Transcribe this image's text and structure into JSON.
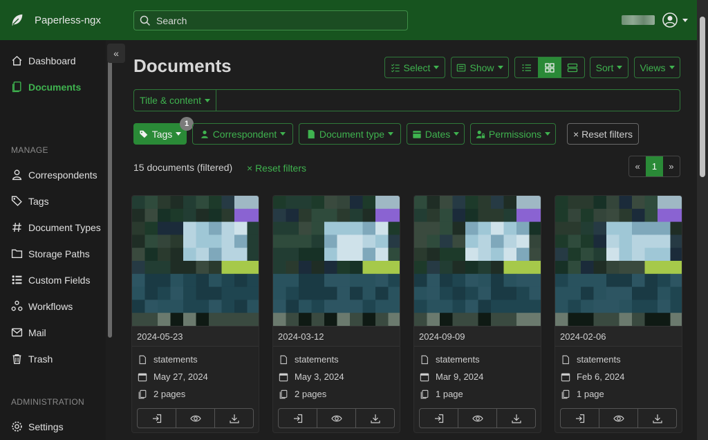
{
  "app": {
    "name": "Paperless-ngx"
  },
  "search": {
    "placeholder": "Search"
  },
  "sidebar": {
    "items_top": [
      {
        "label": "Dashboard",
        "icon": "house-icon"
      },
      {
        "label": "Documents",
        "icon": "documents-icon",
        "active": true
      }
    ],
    "manage_label": "MANAGE",
    "manage_items": [
      {
        "label": "Correspondents",
        "icon": "person-icon"
      },
      {
        "label": "Tags",
        "icon": "tags-icon"
      },
      {
        "label": "Document Types",
        "icon": "hash-icon"
      },
      {
        "label": "Storage Paths",
        "icon": "folder-icon"
      },
      {
        "label": "Custom Fields",
        "icon": "custom-fields-icon"
      },
      {
        "label": "Workflows",
        "icon": "workflows-icon"
      },
      {
        "label": "Mail",
        "icon": "mail-icon"
      },
      {
        "label": "Trash",
        "icon": "trash-icon"
      }
    ],
    "admin_label": "ADMINISTRATION",
    "admin_items": [
      {
        "label": "Settings",
        "icon": "gear-icon"
      }
    ]
  },
  "page": {
    "title": "Documents",
    "toolbar": {
      "select": "Select",
      "show": "Show",
      "sort": "Sort",
      "views": "Views"
    },
    "filter": {
      "type_label": "Title & content"
    },
    "filters": {
      "tags": "Tags",
      "tags_badge": "1",
      "correspondent": "Correspondent",
      "document_type": "Document type",
      "dates": "Dates",
      "permissions": "Permissions",
      "reset": "× Reset filters"
    },
    "count_text": "15 documents (filtered)",
    "reset_link": "× Reset filters",
    "pager": {
      "prev": "«",
      "current": "1",
      "next": "»"
    }
  },
  "documents": [
    {
      "date": "2024-05-23",
      "type": "statements",
      "added": "May 27, 2024",
      "pages": "2 pages"
    },
    {
      "date": "2024-03-12",
      "type": "statements",
      "added": "May 3, 2024",
      "pages": "2 pages"
    },
    {
      "date": "2024-09-09",
      "type": "statements",
      "added": "Mar 9, 2024",
      "pages": "1 page"
    },
    {
      "date": "2024-02-06",
      "type": "statements",
      "added": "Feb 6, 2024",
      "pages": "1 page"
    }
  ],
  "colors": {
    "topbar": "#17541f",
    "accent": "#3fb34f",
    "background": "#1e1e1e"
  }
}
